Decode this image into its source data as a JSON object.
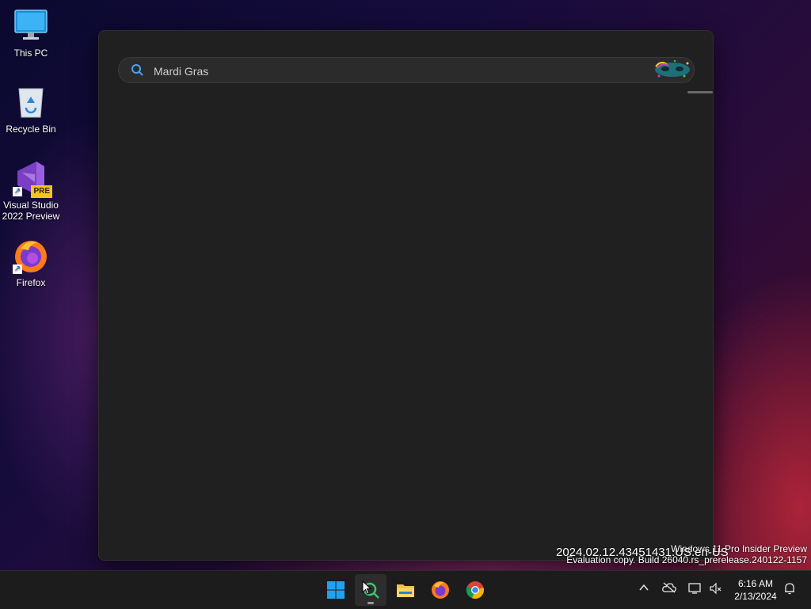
{
  "desktop": {
    "icons": [
      {
        "label": "This PC"
      },
      {
        "label": "Recycle Bin"
      },
      {
        "label": "Visual Studio 2022 Preview",
        "badge": "PRE"
      },
      {
        "label": "Firefox"
      }
    ]
  },
  "search": {
    "query": "Mardi Gras",
    "placeholder": ""
  },
  "watermark": {
    "line1": "Windows 11 Pro Insider Preview",
    "line2": "Evaluation copy. Build 26040.rs_prerelease.240122-1157",
    "build_overlay": "2024.02.12.43451431.US.en-US"
  },
  "taskbar": {
    "apps": [
      "start-icon",
      "search-icon",
      "file-explorer-icon",
      "firefox-icon",
      "chrome-icon"
    ],
    "tray": [
      "chevron-up-icon",
      "onedrive-icon",
      "network-icon",
      "volume-icon",
      "notification-bell-icon"
    ],
    "time": "6:16 AM",
    "date": "2/13/2024"
  },
  "colors": {
    "accent": "#0a84ff",
    "window_bg": "#202020",
    "taskbar_bg": "#1c1c1c"
  }
}
